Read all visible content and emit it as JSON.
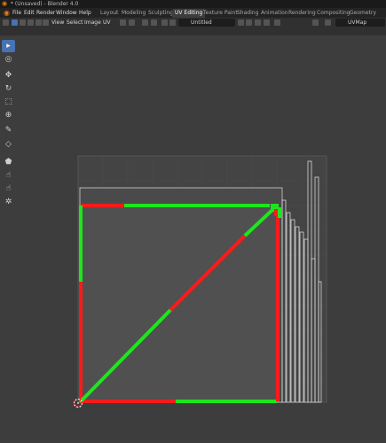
{
  "window": {
    "title": "* (Unsaved) - Blender 4.0"
  },
  "menu": [
    "File",
    "Edit",
    "Render",
    "Window",
    "Help"
  ],
  "workspaces": [
    {
      "label": "Layout",
      "active": false
    },
    {
      "label": "Modeling",
      "active": false
    },
    {
      "label": "Sculpting",
      "active": false
    },
    {
      "label": "UV Editing",
      "active": true
    },
    {
      "label": "Texture Paint",
      "active": false
    },
    {
      "label": "Shading",
      "active": false
    },
    {
      "label": "Animation",
      "active": false
    },
    {
      "label": "Rendering",
      "active": false
    },
    {
      "label": "Compositing",
      "active": false
    },
    {
      "label": "Geometry Nodes",
      "active": false
    }
  ],
  "uv_header": {
    "menus": [
      "View",
      "Select",
      "Image",
      "UV"
    ],
    "image_name": "Untitled",
    "uv_map": "UVMap"
  },
  "tools": [
    {
      "name": "select-box-tool",
      "glyph": "▸",
      "active": true
    },
    {
      "name": "cursor-tool",
      "glyph": "◎",
      "active": false
    },
    {
      "name": "move-tool",
      "glyph": "✥",
      "active": false
    },
    {
      "name": "rotate-tool",
      "glyph": "↻",
      "active": false
    },
    {
      "name": "scale-tool",
      "glyph": "⬚",
      "active": false
    },
    {
      "name": "transform-tool",
      "glyph": "⊕",
      "active": false
    },
    {
      "name": "annotate-tool",
      "glyph": "✎",
      "active": false
    },
    {
      "name": "rip-tool",
      "glyph": "◇",
      "active": false
    },
    {
      "name": "grab-tool",
      "glyph": "⬟",
      "active": false
    },
    {
      "name": "relax-tool",
      "glyph": "☝",
      "active": false
    },
    {
      "name": "pinch-tool",
      "glyph": "☝",
      "active": false
    },
    {
      "name": "sample-tool",
      "glyph": "✲",
      "active": false
    }
  ],
  "colors": {
    "seam": "#ff1a1a",
    "selected_edge": "#1ee61e",
    "accent": "#4772b3",
    "blender_orange": "#e87d0d"
  }
}
